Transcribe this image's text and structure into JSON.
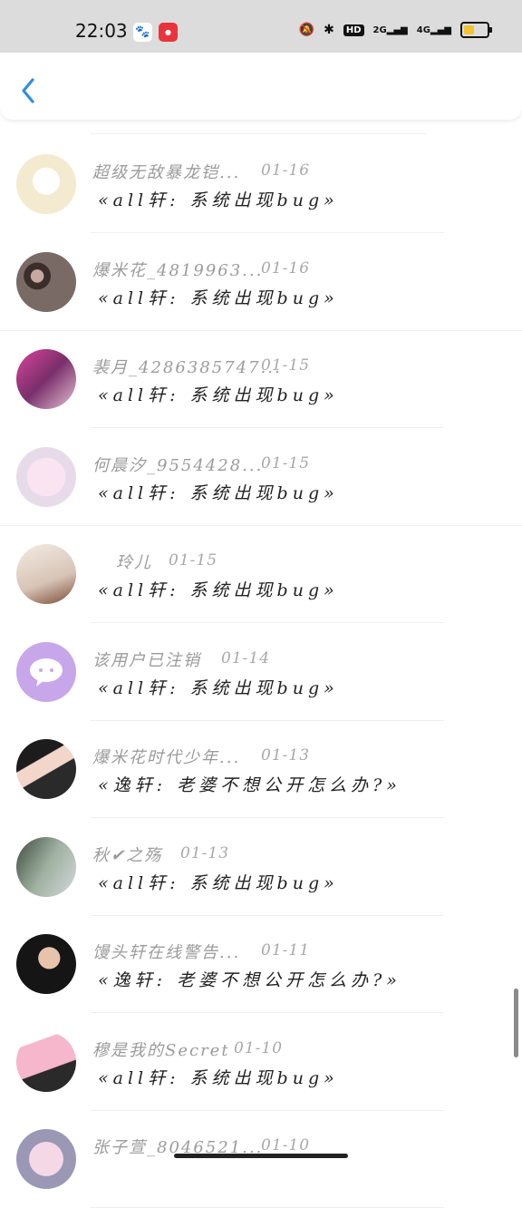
{
  "status_bar": {
    "time": "22:03",
    "icons": [
      "baidu-icon",
      "app-badge-icon",
      "mute-icon",
      "bluetooth-icon"
    ],
    "hd_label": "HD",
    "sig1_label": "2G",
    "sig2_label": "4G",
    "battery_level": 0.55,
    "battery_color": "#f2c230"
  },
  "nav": {
    "back_icon": "chevron-left-icon",
    "accent": "#2f8fe0"
  },
  "messages": [
    {
      "name": "超级无敌暴龙铠...",
      "date": "01-16",
      "text": "«all轩: 系统出现bug»"
    },
    {
      "name": "爆米花_4819963...",
      "date": "01-16",
      "text": "«all轩: 系统出现bug»"
    },
    {
      "name": "裴月_4286385747...",
      "date": "01-15",
      "text": "«all轩: 系统出现bug»"
    },
    {
      "name": "何晨汐_9554428...",
      "date": "01-15",
      "text": "«all轩: 系统出现bug»"
    },
    {
      "name": "玲儿",
      "date": "01-15",
      "text": "«all轩: 系统出现bug»"
    },
    {
      "name": "该用户已注销",
      "date": "01-14",
      "text": "«all轩: 系统出现bug»"
    },
    {
      "name": "爆米花时代少年...",
      "date": "01-13",
      "text": "«逸轩: 老婆不想公开怎么办?»"
    },
    {
      "name": "秋✔之殇",
      "date": "01-13",
      "text": "«all轩: 系统出现bug»"
    },
    {
      "name": "馒头轩在线警告...",
      "date": "01-11",
      "text": "«逸轩: 老婆不想公开怎么办?»"
    },
    {
      "name": "穆是我的Secret",
      "date": "01-10",
      "text": "«all轩: 系统出现bug»"
    },
    {
      "name": "张子萱_8046521...",
      "date": "01-10",
      "text": ""
    }
  ]
}
